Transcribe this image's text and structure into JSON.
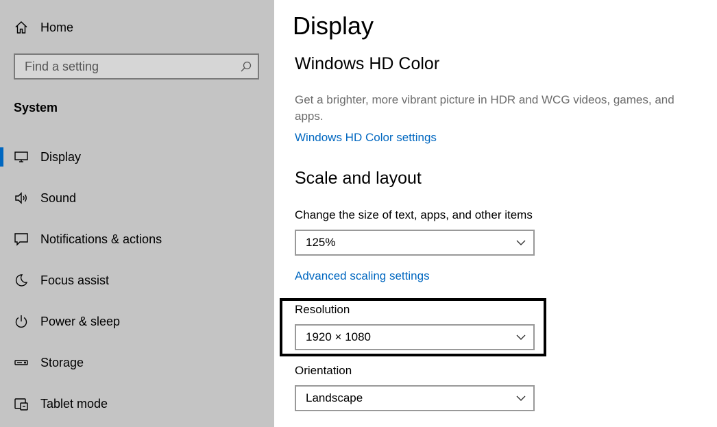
{
  "sidebar": {
    "home": {
      "label": "Home",
      "icon": "home-icon"
    },
    "search": {
      "placeholder": "Find a setting",
      "icon": "search-icon"
    },
    "section_heading": "System",
    "items": [
      {
        "label": "Display",
        "icon": "monitor-icon",
        "active": true
      },
      {
        "label": "Sound",
        "icon": "speaker-icon",
        "active": false
      },
      {
        "label": "Notifications & actions",
        "icon": "notification-icon",
        "active": false
      },
      {
        "label": "Focus assist",
        "icon": "moon-icon",
        "active": false
      },
      {
        "label": "Power & sleep",
        "icon": "power-icon",
        "active": false
      },
      {
        "label": "Storage",
        "icon": "storage-icon",
        "active": false
      },
      {
        "label": "Tablet mode",
        "icon": "tablet-mode-icon",
        "active": false
      }
    ]
  },
  "main": {
    "title": "Display",
    "hd_color": {
      "heading": "Windows HD Color",
      "description": "Get a brighter, more vibrant picture in HDR and WCG videos, games, and apps.",
      "link": "Windows HD Color settings"
    },
    "scale_layout": {
      "heading": "Scale and layout",
      "scale_label": "Change the size of text, apps, and other items",
      "scale_value": "125%",
      "advanced_link": "Advanced scaling settings",
      "resolution_label": "Resolution",
      "resolution_value": "1920 × 1080",
      "orientation_label": "Orientation",
      "orientation_value": "Landscape"
    }
  },
  "colors": {
    "sidebar_bg": "#c4c4c4",
    "accent": "#0067c0",
    "link": "#0067c0",
    "description_text": "#6b6b6b"
  }
}
